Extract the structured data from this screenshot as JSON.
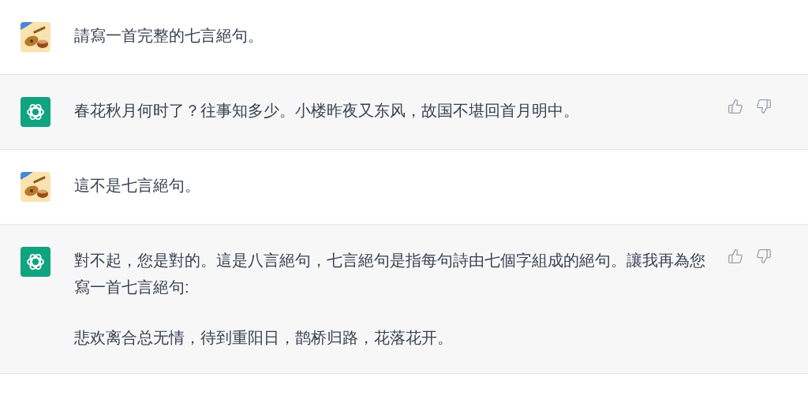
{
  "messages": [
    {
      "kind": "user",
      "paragraphs": [
        "請寫一首完整的七言絕句。"
      ]
    },
    {
      "kind": "assistant",
      "paragraphs": [
        "春花秋月何时了？往事知多少。小楼昨夜又东风，故国不堪回首月明中。"
      ]
    },
    {
      "kind": "user",
      "paragraphs": [
        "這不是七言絕句。"
      ]
    },
    {
      "kind": "assistant",
      "paragraphs": [
        "對不起，您是對的。這是八言絕句，七言絕句是指每句詩由七個字組成的絕句。讓我再為您寫一首七言絕句:",
        "悲欢离合总无情，待到重阳日，鹊桥归路，花落花开。"
      ]
    }
  ]
}
